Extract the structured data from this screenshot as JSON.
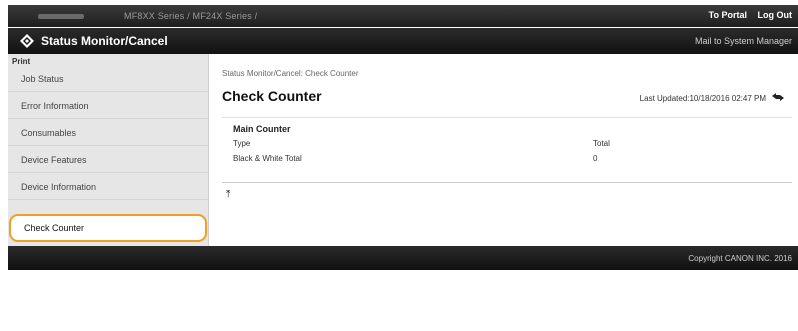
{
  "header": {
    "device_name": "MF8XX Series / MF24X Series /",
    "to_portal": "To Portal",
    "log_out": "Log Out"
  },
  "titlebar": {
    "title": "Status Monitor/Cancel",
    "mail": "Mail to System Manager"
  },
  "sidebar": {
    "heading": "Print",
    "items": [
      {
        "label": "Job Status"
      },
      {
        "label": "Error Information"
      },
      {
        "label": "Consumables"
      },
      {
        "label": "Device Features"
      },
      {
        "label": "Device Information"
      },
      {
        "label": "Check Counter"
      }
    ],
    "active_color": "#f0a020"
  },
  "main": {
    "breadcrumb": "Status Monitor/Cancel: Check Counter",
    "title": "Check Counter",
    "last_updated": "Last Updated:10/18/2016 02:47 PM",
    "refresh_icon": "refresh-icon",
    "section": {
      "title": "Main Counter",
      "headers": [
        "Type",
        "Total"
      ],
      "rows": [
        [
          "Black & White Total",
          "0"
        ]
      ]
    },
    "top_icon": "back-to-top-icon"
  },
  "footer": {
    "copyright": "Copyright CANON INC. 2016"
  }
}
